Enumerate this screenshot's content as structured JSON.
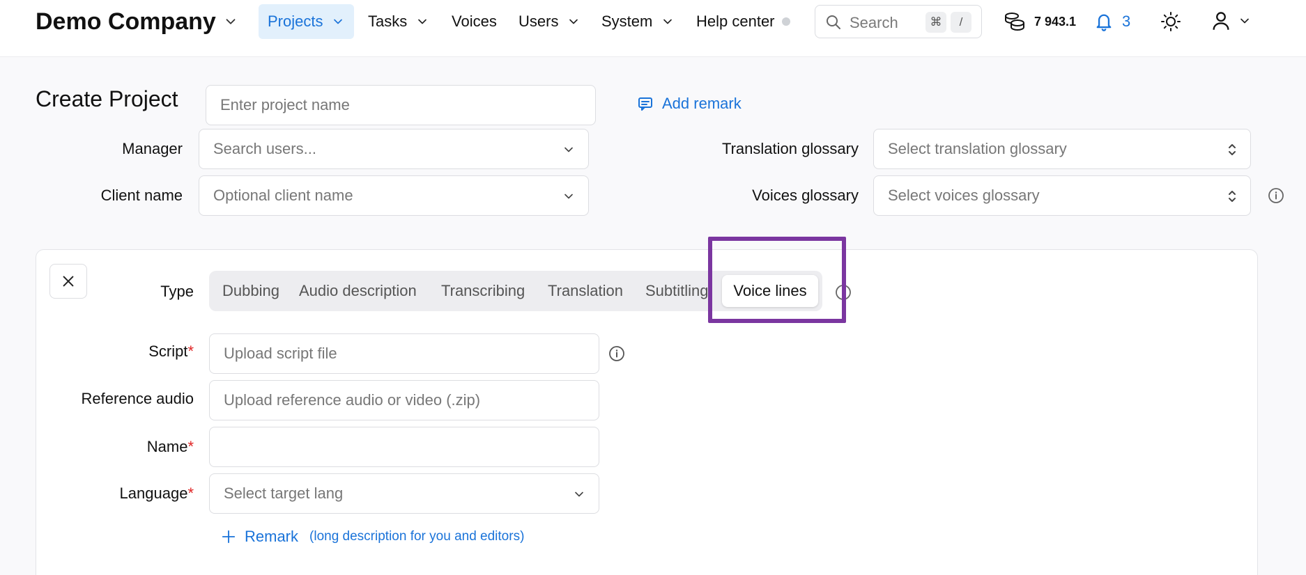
{
  "header": {
    "company": "Demo Company",
    "nav": [
      {
        "label": "Projects",
        "active": true
      },
      {
        "label": "Tasks"
      },
      {
        "label": "Voices"
      },
      {
        "label": "Users"
      },
      {
        "label": "System"
      },
      {
        "label": "Help center"
      }
    ],
    "search": {
      "placeholder": "Search",
      "shortcut_mod": "⌘",
      "shortcut_key": "/"
    },
    "balance": "7 943.1",
    "notifications_count": "3"
  },
  "page": {
    "title": "Create Project",
    "project_name_placeholder": "Enter project name",
    "add_remark_label": "Add remark",
    "manager_label": "Manager",
    "manager_placeholder": "Search users...",
    "client_label": "Client name",
    "client_placeholder": "Optional client name",
    "translation_glossary_label": "Translation glossary",
    "translation_glossary_placeholder": "Select translation glossary",
    "voices_glossary_label": "Voices glossary",
    "voices_glossary_placeholder": "Select voices glossary"
  },
  "task": {
    "type_label": "Type",
    "types": [
      "Dubbing",
      "Audio description",
      "Transcribing",
      "Translation",
      "Subtitling",
      "Voice lines"
    ],
    "selected_type": "Voice lines",
    "script_label": "Script",
    "script_placeholder": "Upload script file",
    "reference_label": "Reference audio",
    "reference_placeholder": "Upload reference audio or video (.zip)",
    "name_label": "Name",
    "name_value": "",
    "language_label": "Language",
    "language_placeholder": "Select target lang",
    "required_mark": "*",
    "remark_label": "Remark",
    "remark_note": "(long description for you and editors)"
  },
  "colors": {
    "accent": "#1a73d9",
    "active_nav_bg": "#e2f0fc",
    "highlight": "#7b36a0",
    "required": "#e02424"
  }
}
